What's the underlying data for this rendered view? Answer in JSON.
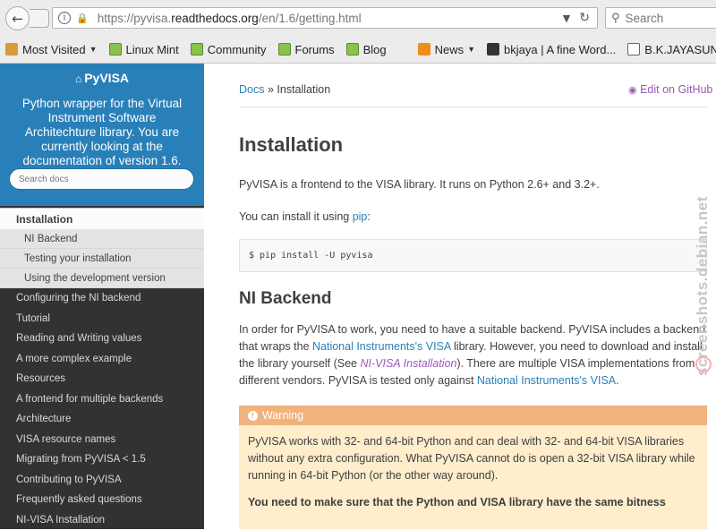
{
  "browser": {
    "url_prefix": "https://pyvisa.",
    "url_host": "readthedocs.org",
    "url_path": "/en/1.6/getting.html",
    "search_placeholder": "Search",
    "bookmarks": [
      {
        "label": "Most Visited",
        "icon": "folder-icon",
        "dropdown": true
      },
      {
        "label": "Linux Mint",
        "icon": "mint-icon"
      },
      {
        "label": "Community",
        "icon": "mint-icon"
      },
      {
        "label": "Forums",
        "icon": "mint-icon"
      },
      {
        "label": "Blog",
        "icon": "mint-icon"
      },
      {
        "label": "News",
        "icon": "rss-icon",
        "dropdown": true
      },
      {
        "label": "bkjaya | A fine Word...",
        "icon": "page-icon"
      },
      {
        "label": "B.K.JAYASUNDERA'S ...",
        "icon": "doc-icon"
      },
      {
        "label": "",
        "icon": "yahoo-icon"
      }
    ]
  },
  "sidebar": {
    "project": "PyVISA",
    "tagline": "Python wrapper for the Virtual Instrument Software Architechture library. You are currently looking at the documentation of version 1.6.",
    "search_placeholder": "Search docs",
    "current": "Installation",
    "subitems": [
      "NI Backend",
      "Testing your installation",
      "Using the development version"
    ],
    "items": [
      "Configuring the NI backend",
      "Tutorial",
      "Reading and Writing values",
      "A more complex example",
      "Resources",
      "A frontend for multiple backends",
      "Architecture",
      "VISA resource names",
      "Migrating from PyVISA < 1.5",
      "Contributing to PyVISA",
      "Frequently asked questions",
      "NI-VISA Installation"
    ]
  },
  "content": {
    "breadcrumb_link": "Docs",
    "breadcrumb_sep": "»",
    "breadcrumb_current": "Installation",
    "edit_link": "Edit on GitHub",
    "title": "Installation",
    "intro": "PyVISA is a frontend to the VISA library. It runs on Python 2.6+ and 3.2+.",
    "install_text": "You can install it using ",
    "install_link": "pip",
    "install_end": ":",
    "code": "$ pip install -U pyvisa",
    "ni_heading": "NI Backend",
    "ni_p1": "In order for PyVISA to work, you need to have a suitable backend. PyVISA includes a backend that wraps the ",
    "ni_link1": "National Instruments's VISA",
    "ni_p2": " library. However, you need to download and install the library yourself (See ",
    "ni_link2": "NI-VISA Installation",
    "ni_p3": "). There are multiple VISA implementations from different vendors. PyVISA is tested only against ",
    "ni_link3": "National Instruments's VISA",
    "ni_p4": ".",
    "warning_title": "Warning",
    "warning_body": "PyVISA works with 32- and 64-bit Python and can deal with 32- and 64-bit VISA libraries without any extra configuration. What PyVISA cannot do is open a 32-bit VISA library while running in 64-bit Python (or the other way around).",
    "warning_strong": "You need to make sure that the Python and VISA library have the same bitness"
  },
  "watermark": "screenshots.debian.net",
  "colors": {
    "sidebar_bg": "#343131",
    "sidebar_head": "#2980b9",
    "link": "#2980b9",
    "visited": "#9b59b6",
    "warning_title": "#f0b37e",
    "warning_bg": "#ffedcc"
  }
}
